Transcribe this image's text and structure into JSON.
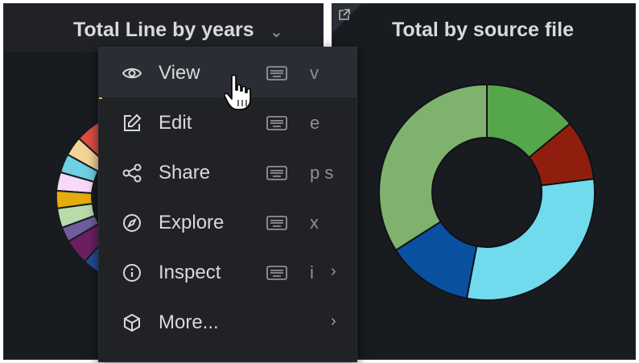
{
  "panel_left": {
    "title": "Total Line by years"
  },
  "panel_right": {
    "title": "Total by source file"
  },
  "menu": {
    "items": [
      {
        "label": "View",
        "icon": "eye-icon",
        "shortcut": "v"
      },
      {
        "label": "Edit",
        "icon": "edit-icon",
        "shortcut": "e"
      },
      {
        "label": "Share",
        "icon": "share-icon",
        "shortcut": "p s"
      },
      {
        "label": "Explore",
        "icon": "compass-icon",
        "shortcut": "x"
      },
      {
        "label": "Inspect",
        "icon": "info-icon",
        "shortcut": "i"
      },
      {
        "label": "More...",
        "icon": "cube-icon",
        "shortcut": ""
      }
    ]
  },
  "chart_data": [
    {
      "type": "pie",
      "title": "Total by source file",
      "style": "donut",
      "labels": [],
      "values": [
        14,
        9,
        30,
        13,
        34
      ],
      "colors": [
        "#56a64b",
        "#8f1e0f",
        "#70dbed",
        "#0a50a1",
        "#7eb26d"
      ]
    }
  ],
  "colors": {
    "panel_bg": "#181b1f",
    "menu_bg": "#202226",
    "accent": "#ff8833"
  }
}
